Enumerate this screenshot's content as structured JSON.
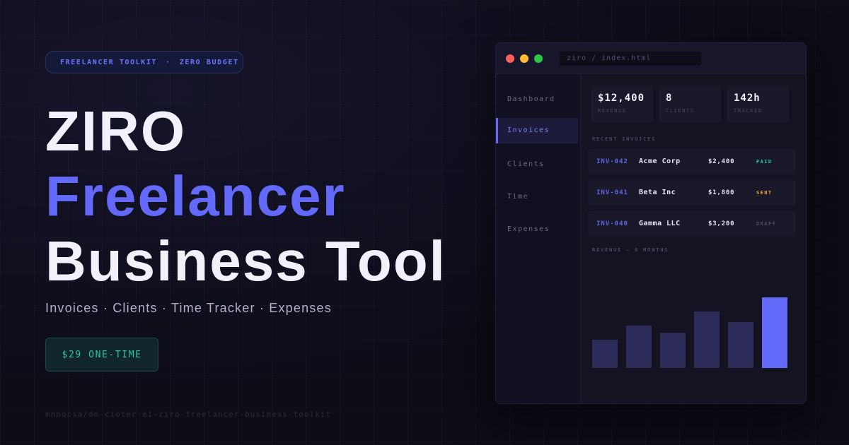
{
  "hero": {
    "tag_left": "FREELANCER TOOLKIT",
    "tag_sep": "·",
    "tag_right": "ZERO BUDGET",
    "title_line1": "ZIRO",
    "title_line2": "Freelancer",
    "title_line3": "Business Tool",
    "features": "Invoices · Clients · Time Tracker · Expenses",
    "price": "$29 ONE-TIME",
    "repo": "mnnocsa/dm-cioter-ei-ziro-freelancer-business-toolkit"
  },
  "window": {
    "url": "ziro / index.html",
    "nav": [
      {
        "label": "Dashboard",
        "active": false
      },
      {
        "label": "Invoices",
        "active": true
      },
      {
        "label": "Clients",
        "active": false
      },
      {
        "label": "Time",
        "active": false
      },
      {
        "label": "Expenses",
        "active": false
      }
    ],
    "stats": [
      {
        "value": "$12,400",
        "label": "REVENUE"
      },
      {
        "value": "8",
        "label": "CLIENTS"
      },
      {
        "value": "142h",
        "label": "TRACKED"
      }
    ],
    "recent_label": "RECENT INVOICES",
    "invoices": [
      {
        "id": "INV-042",
        "client": "Acme Corp",
        "amount": "$2,400",
        "status": "PAID",
        "status_color": "#2fc4a0"
      },
      {
        "id": "INV-041",
        "client": "Beta Inc",
        "amount": "$1,800",
        "status": "SENT",
        "status_color": "#f0a030"
      },
      {
        "id": "INV-040",
        "client": "Gamma LLC",
        "amount": "$3,200",
        "status": "DRAFT",
        "status_color": "#4f4d68"
      }
    ],
    "revenue_label": "REVENUE — 6 MONTHS"
  },
  "chart_data": {
    "type": "bar",
    "values": [
      40,
      60,
      50,
      80,
      65,
      100
    ],
    "highlight_index": 5,
    "colors": {
      "bar": "#2d2c5a",
      "highlight": "#6369f8"
    }
  },
  "colors": {
    "accent": "#6369f8",
    "green": "#2fc4a0",
    "orange": "#f0a030",
    "background": "#0d0c17"
  }
}
